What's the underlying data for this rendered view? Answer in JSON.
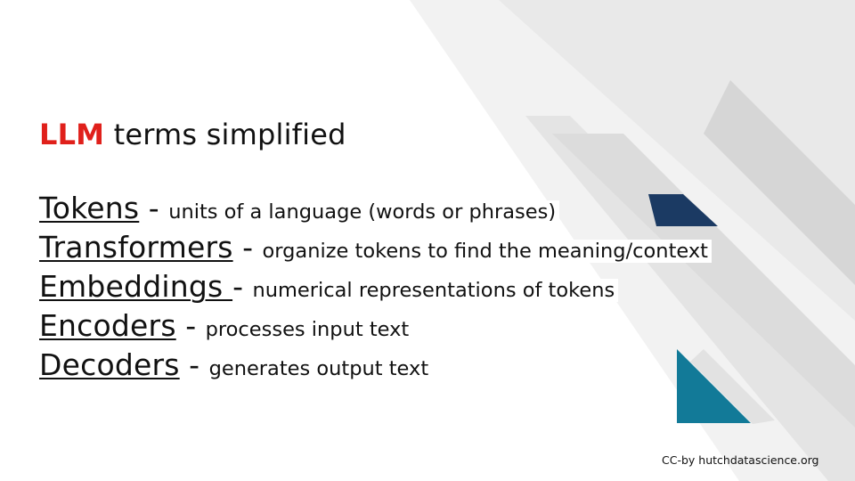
{
  "slide": {
    "title_accent": "LLM",
    "title_rest": " terms simplified",
    "terms": [
      {
        "term": "Tokens",
        "dash": " - ",
        "definition": "units of a language (words or phrases)"
      },
      {
        "term": "Transformers",
        "dash": " - ",
        "definition": "organize tokens to find the meaning/context"
      },
      {
        "term": "Embeddings ",
        "dash": "- ",
        "definition": "numerical representations of tokens"
      },
      {
        "term": "Encoders",
        "dash": " - ",
        "definition": "processes input text"
      },
      {
        "term": "Decoders",
        "dash": " - ",
        "definition": "generates output text"
      }
    ],
    "credit": "CC-by hutchdatascience.org"
  },
  "colors": {
    "accent_red": "#e0201b",
    "navy": "#1b3a63",
    "teal": "#127a98",
    "light_gray": "#ececec",
    "mid_gray": "#dedede"
  }
}
